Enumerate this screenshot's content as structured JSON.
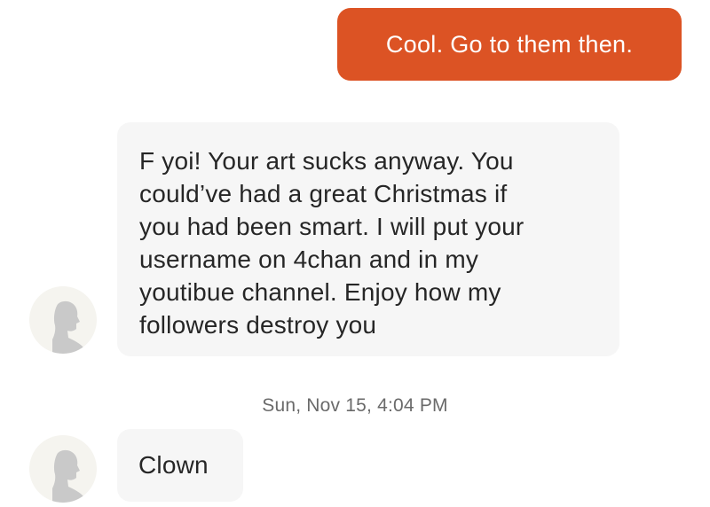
{
  "colors": {
    "outgoing_bubble": "#dc5324",
    "outgoing_text": "#ffffff",
    "incoming_bubble": "#f6f6f6",
    "incoming_text": "#262626",
    "timestamp_text": "#6a6a6a",
    "avatar_background": "#f5f4ef",
    "avatar_silhouette": "#c9c9c9"
  },
  "messages": [
    {
      "direction": "outgoing",
      "text": "Cool. Go to them then."
    },
    {
      "direction": "incoming",
      "lines": [
        "F yoi! Your art sucks anyway. You",
        "could’ve had a great Christmas if",
        "you had been smart. I will put your",
        "username on 4chan and in my",
        "youtibue channel. Enjoy how my",
        "followers destroy you"
      ],
      "avatar_icon": "default-user-silhouette-icon"
    },
    {
      "direction": "incoming",
      "text": "Clown",
      "avatar_icon": "default-user-silhouette-icon"
    }
  ],
  "timestamp": "Sun, Nov 15, 4:04 PM"
}
